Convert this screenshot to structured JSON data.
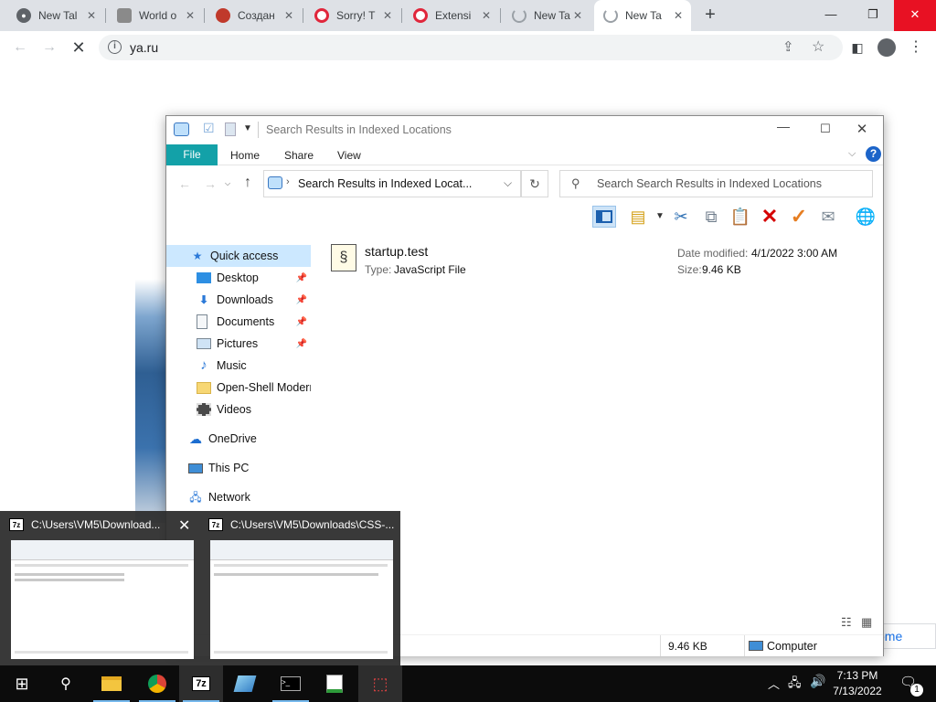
{
  "browser": {
    "tabs": [
      {
        "title": "New Tal",
        "favicon": "chrome-icon"
      },
      {
        "title": "World o",
        "favicon": "shield-icon"
      },
      {
        "title": "Создан",
        "favicon": "opera-like-icon"
      },
      {
        "title": "Sorry! T",
        "favicon": "opera-icon"
      },
      {
        "title": "Extensi",
        "favicon": "opera-icon"
      },
      {
        "title": "New Ta",
        "favicon": "loading-icon"
      },
      {
        "title": "New Ta",
        "favicon": "loading-icon"
      }
    ],
    "address": "ya.ru",
    "page_link": "ome"
  },
  "explorer": {
    "title": "Search Results in Indexed Locations",
    "ribbon_tabs": [
      "File",
      "Home",
      "Share",
      "View"
    ],
    "breadcrumb": "Search Results in Indexed Locat...",
    "search_placeholder": "Search Search Results in Indexed Locations",
    "sidebar": [
      {
        "label": "Quick access",
        "icon": "star-icon",
        "pinned": false,
        "selected": true
      },
      {
        "label": "Desktop",
        "icon": "desktop-icon",
        "pinned": true
      },
      {
        "label": "Downloads",
        "icon": "download-icon",
        "pinned": true
      },
      {
        "label": "Documents",
        "icon": "documents-icon",
        "pinned": true
      },
      {
        "label": "Pictures",
        "icon": "pictures-icon",
        "pinned": true
      },
      {
        "label": "Music",
        "icon": "music-icon",
        "pinned": false
      },
      {
        "label": "Open-Shell Modern",
        "icon": "folder-icon",
        "pinned": false
      },
      {
        "label": "Videos",
        "icon": "videos-icon",
        "pinned": false
      },
      {
        "label": "OneDrive",
        "icon": "cloud-icon",
        "pinned": false
      },
      {
        "label": "This PC",
        "icon": "pc-icon",
        "pinned": false
      },
      {
        "label": "Network",
        "icon": "network-icon",
        "pinned": false
      }
    ],
    "file": {
      "name": "startup.test",
      "type_label": "Type:",
      "type": "JavaScript File",
      "date_label": "Date modified:",
      "date": "4/1/2022 3:00 AM",
      "size_label": "Size:",
      "size": "9.46 KB"
    },
    "status": {
      "size": "9.46 KB",
      "location": "Computer"
    }
  },
  "thumbnails": [
    {
      "title": "C:\\Users\\VM5\\Download..."
    },
    {
      "title": "C:\\Users\\VM5\\Downloads\\CSS-..."
    }
  ],
  "taskbar": {
    "app_7z": "7z",
    "time": "7:13 PM",
    "date": "7/13/2022",
    "notif_count": "1"
  }
}
